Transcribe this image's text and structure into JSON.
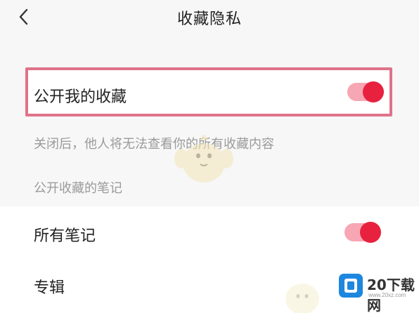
{
  "header": {
    "title": "收藏隐私"
  },
  "settings": {
    "public_collection": {
      "label": "公开我的收藏",
      "enabled": true
    },
    "hint": "关闭后，他人将无法查看你的所有收藏内容",
    "section_label": "公开收藏的笔记",
    "all_notes": {
      "label": "所有笔记",
      "enabled": true
    },
    "albums": {
      "label": "专辑"
    }
  },
  "watermark": {
    "brand_name": "20下载网",
    "brand_url": "www.20xz.com"
  },
  "colors": {
    "accent": "#e8213f",
    "toggle_track": "#f7a6b4",
    "highlight_border": "#e0728a",
    "hint_text": "#9a9a9a",
    "brand_blue": "#1d87e0"
  },
  "icons": {
    "back": "chevron-left-icon",
    "mascot": "mascot-watermark",
    "brand_logo": "cube-logo"
  }
}
